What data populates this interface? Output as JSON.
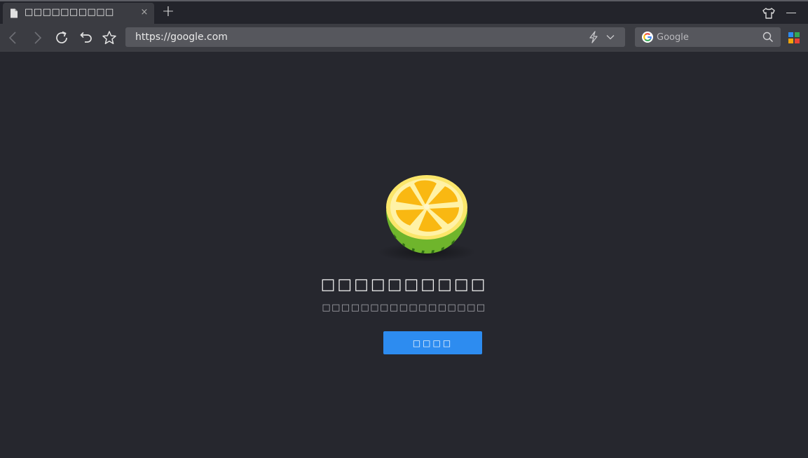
{
  "tab": {
    "title": "□□□□□□□□□□",
    "close_label": "×",
    "new_tab_label": "+"
  },
  "address_bar": {
    "url": "https://google.com"
  },
  "search": {
    "placeholder": "Google"
  },
  "main": {
    "headline": "□□□□□□□□□□",
    "subline": "□□□□□□□□□□□□□□□□□",
    "button_label": "□□□□"
  },
  "icons": [
    "document-icon",
    "close-icon",
    "plus-icon",
    "skin-shirt-icon",
    "minimize-icon",
    "back-icon",
    "forward-icon",
    "reload-icon",
    "undo-icon",
    "star-icon",
    "bolt-icon",
    "chevron-down-icon",
    "google-icon",
    "search-icon",
    "apps-grid-icon",
    "watermelon-logo"
  ],
  "colors": {
    "background": "#26272e",
    "toolbar": "#3b3c42",
    "field": "#56575d",
    "accent": "#2d8cf0"
  }
}
